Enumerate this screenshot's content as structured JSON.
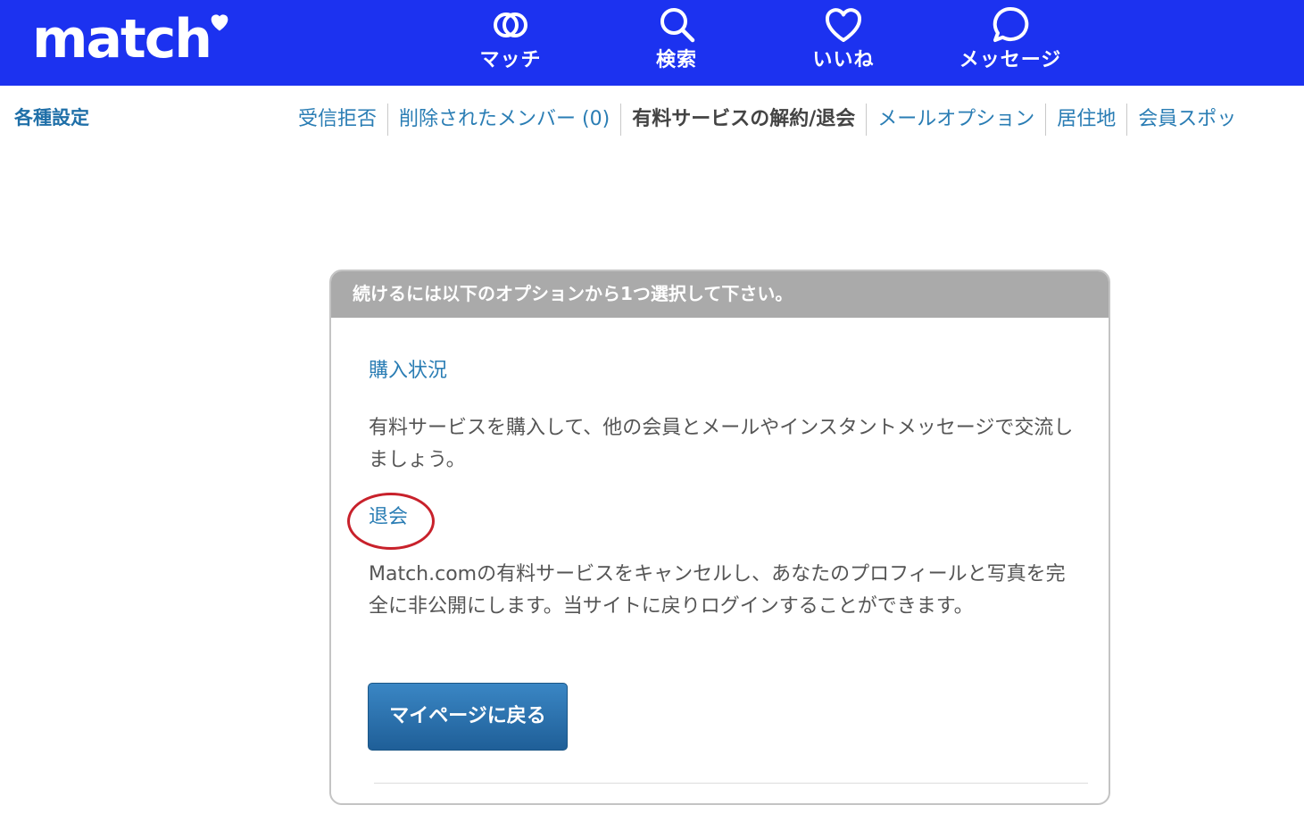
{
  "header": {
    "logo_text": "match",
    "nav": [
      {
        "label": "マッチ",
        "icon": "match-rings-icon"
      },
      {
        "label": "検索",
        "icon": "search-icon"
      },
      {
        "label": "いいね",
        "icon": "heart-icon"
      },
      {
        "label": "メッセージ",
        "icon": "message-bubble-icon"
      }
    ],
    "colors": {
      "background": "#1c32f0",
      "foreground": "#ffffff"
    }
  },
  "settings": {
    "title": "各種設定",
    "tabs": [
      {
        "label": "受信拒否",
        "active": false
      },
      {
        "label": "削除されたメンバー (0)",
        "active": false
      },
      {
        "label": "有料サービスの解約/退会",
        "active": true
      },
      {
        "label": "メールオプション",
        "active": false
      },
      {
        "label": "居住地",
        "active": false
      },
      {
        "label": "会員スポッ",
        "active": false
      }
    ]
  },
  "card": {
    "header": "続けるには以下のオプションから1つ選択して下さい。",
    "options": [
      {
        "title": "購入状況",
        "description": "有料サービスを購入して、他の会員とメールやインスタントメッセージで交流しましょう。"
      },
      {
        "title": "退会",
        "description": "Match.comの有料サービスをキャンセルし、あなたのプロフィールと写真を完全に非公開にします。当サイトに戻りログインすることができます。",
        "highlighted": true
      }
    ],
    "back_button": "マイページに戻る"
  },
  "colors": {
    "link": "#2a7db4",
    "settings_title": "#1f6fa8",
    "text": "#555555",
    "card_header": "#aaaaaa",
    "button": "#2a70ad",
    "highlight_ring": "#c8212b"
  }
}
